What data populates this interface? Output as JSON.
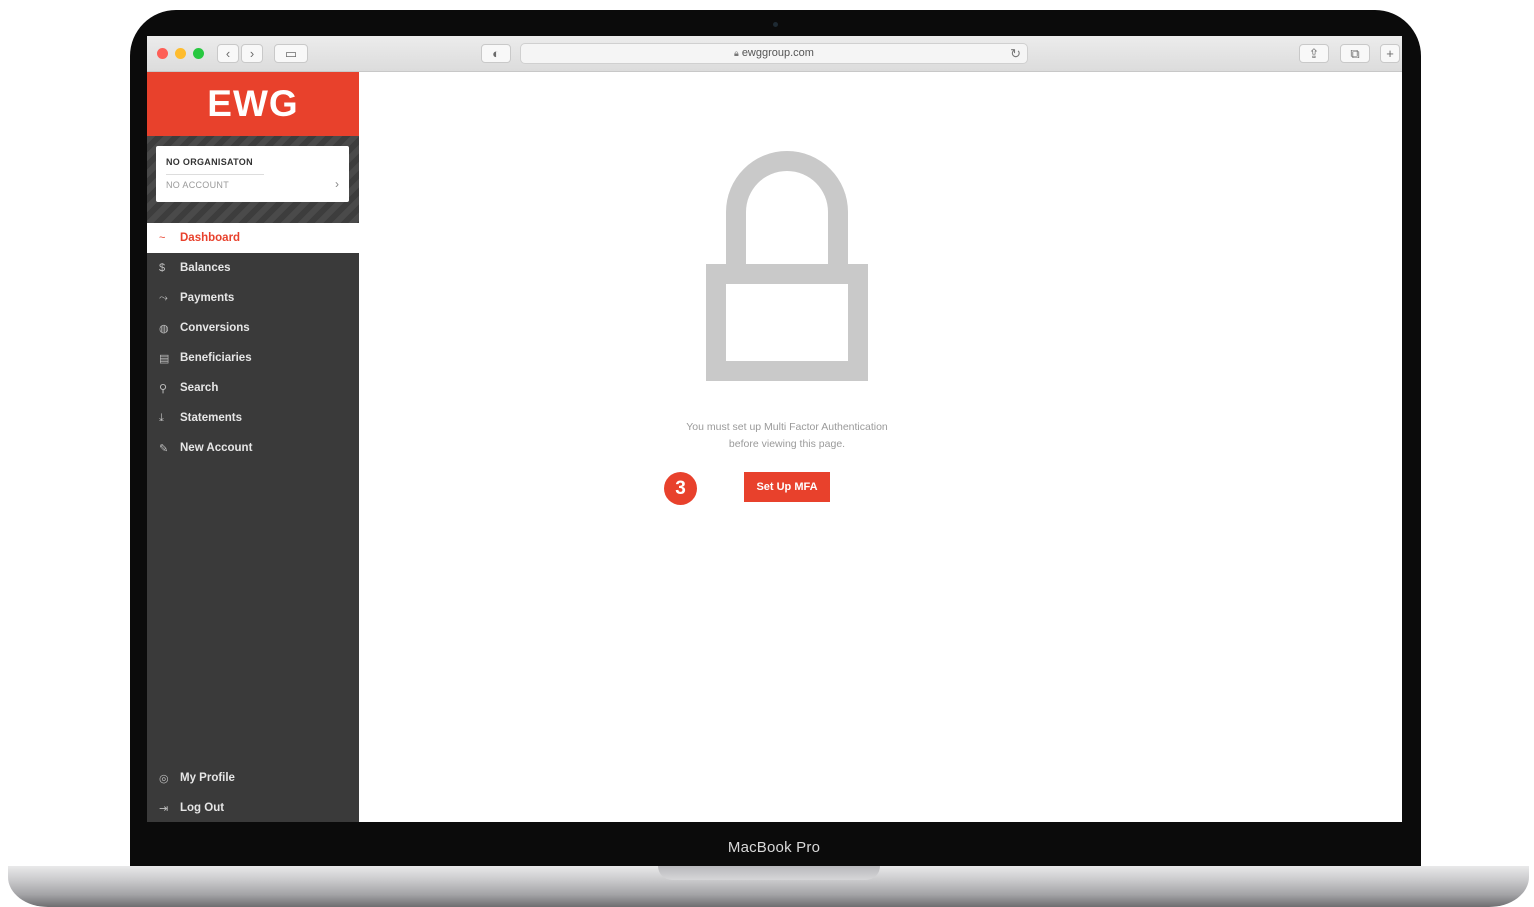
{
  "browser": {
    "url": "ewggroup.com",
    "back_icon": "chevron-left-icon",
    "forward_icon": "chevron-right-icon"
  },
  "brand": {
    "logo_text": "EWG",
    "color": "#e8412c"
  },
  "organisation": {
    "name": "NO ORGANISATON",
    "account": "NO ACCOUNT"
  },
  "sidebar": {
    "items": [
      {
        "label": "Dashboard",
        "icon": "~",
        "active": true
      },
      {
        "label": "Balances",
        "icon": "$"
      },
      {
        "label": "Payments",
        "icon": "⤳"
      },
      {
        "label": "Conversions",
        "icon": "◍"
      },
      {
        "label": "Beneficiaries",
        "icon": "▤"
      },
      {
        "label": "Search",
        "icon": "⚲"
      },
      {
        "label": "Statements",
        "icon": "⤓"
      },
      {
        "label": "New Account",
        "icon": "✎"
      }
    ],
    "bottom_items": [
      {
        "label": "My Profile",
        "icon": "◎"
      },
      {
        "label": "Log Out",
        "icon": "⇥"
      }
    ]
  },
  "main": {
    "message_line1": "You must set up Multi Factor Authentication",
    "message_line2": "before viewing this page.",
    "button_label": "Set Up MFA",
    "step_number": "3"
  },
  "device": {
    "label": "MacBook Pro"
  }
}
